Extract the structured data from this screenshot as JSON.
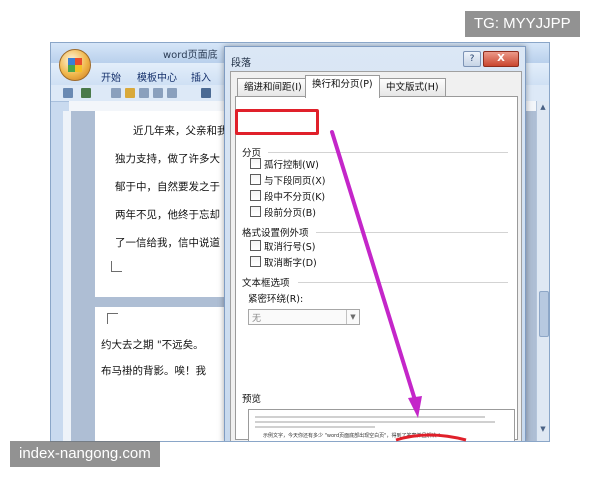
{
  "word": {
    "title": "word页面底",
    "tabs": [
      "开始",
      "模板中心",
      "插入"
    ],
    "page1_lines": [
      "近几年来，父亲和我",
      "独力支持，做了许多大",
      "郁于中，自然要发之于",
      "两年不见，他终于忘却",
      "了一信给我，信中说道"
    ],
    "page2_lines": [
      "约大去之期 \"不远矣。",
      "布马褂的背影。唉！我"
    ]
  },
  "dialog": {
    "title": "段落",
    "help": "?",
    "close": "X",
    "tabs": [
      "缩进和间距(I)",
      "换行和分页(P)",
      "中文版式(H)"
    ],
    "pagination": {
      "label": "分页",
      "options": [
        "孤行控制(W)",
        "与下段同页(X)",
        "段中不分页(K)",
        "段前分页(B)"
      ]
    },
    "exceptions": {
      "label": "格式设置例外项",
      "options": [
        "取消行号(S)",
        "取消断字(D)"
      ]
    },
    "textbox": {
      "label": "文本框选项",
      "wrap_label": "紧密环绕(R):",
      "wrap_value": "无"
    },
    "preview": {
      "label": "预览",
      "sample": "示例文字，今天你还有多少 \"word页面底部出现空白页\"，得到了答案并且解决 !"
    }
  },
  "overlays": {
    "watermark_top": "TG: MYYJJPP",
    "watermark_bottom": "index-nangong.com"
  },
  "colors": {
    "highlight": "#e0202a",
    "arrow": "#c426c9",
    "ribbon": "#cfe0f4"
  }
}
